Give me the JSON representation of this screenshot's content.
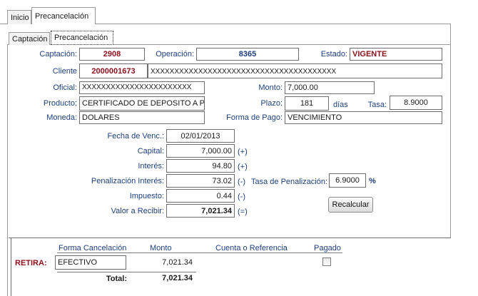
{
  "top_tabs": [
    "Inicio",
    "Precancelación"
  ],
  "inner_tabs": [
    "Captación",
    "Precancelación"
  ],
  "header": {
    "captacion_label": "Captación:",
    "captacion_value": "2908",
    "operacion_label": "Operación:",
    "operacion_value": "8365",
    "estado_label": "Estado:",
    "estado_value": "VIGENTE",
    "cliente_label": "Cliente",
    "cliente_value": "2000001673",
    "cliente_name": "XXXXXXXXXXXXXXXXXXXXXXXXXXXXXXXXXXXXXXX",
    "oficial_label": "Oficial:",
    "oficial_value": "XXXXXXXXXXXXXXXXXXXXXXX",
    "monto_label": "Monto:",
    "monto_value": "7,000.00",
    "producto_label": "Producto:",
    "producto_value": "CERTIFICADO DE DEPOSITO A PLAZ",
    "plazo_label": "Plazo:",
    "plazo_value": "181",
    "plazo_unit": "días",
    "tasa_label": "Tasa:",
    "tasa_value": "8.9000",
    "moneda_label": "Moneda:",
    "moneda_value": "DOLARES",
    "forma_pago_label": "Forma de Pago:",
    "forma_pago_value": "VENCIMIENTO"
  },
  "calc": {
    "fecha_label": "Fecha de Venc.:",
    "fecha_value": "02/01/2013",
    "capital_label": "Capital:",
    "capital_value": "7,000.00",
    "capital_sign": "(+)",
    "interes_label": "Interés:",
    "interes_value": "94.80",
    "interes_sign": "(+)",
    "penal_label": "Penalización Interés:",
    "penal_value": "73.02",
    "penal_sign": "(-)",
    "tasa_penal_label": "Tasa de Penalización:",
    "tasa_penal_value": "6.9000",
    "tasa_penal_unit": "%",
    "impuesto_label": "Impuesto:",
    "impuesto_value": "0.44",
    "impuesto_sign": "(-)",
    "valor_label": "Valor a Recibir:",
    "valor_value": "7,021.34",
    "valor_sign": "(=)",
    "recalcular_label": "Recalcular"
  },
  "cancel_table": {
    "headers": [
      "Forma Cancelación",
      "Monto",
      "Cuenta o Referencia",
      "Pagado"
    ],
    "row_label": "RETIRA:",
    "forma_value": "EFECTIVO",
    "monto_value": "7,021.34",
    "total_label": "Total:",
    "total_value": "7,021.34"
  }
}
